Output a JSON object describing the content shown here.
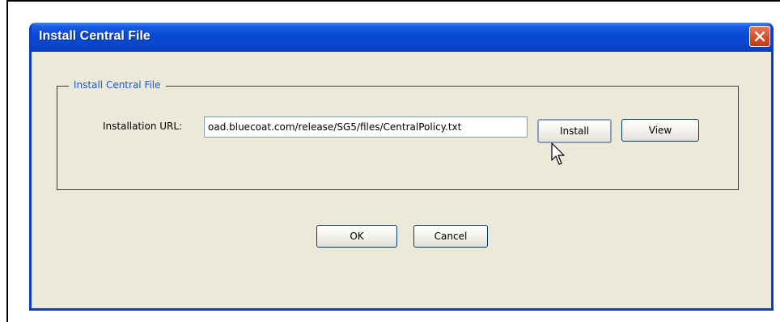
{
  "window": {
    "title": "Install Central File",
    "close_icon": "close-icon"
  },
  "group": {
    "legend": "Install Central File",
    "url_label": "Installation URL:",
    "url_value": "oad.bluecoat.com/release/SG5/files/CentralPolicy.txt",
    "install_label": "Install",
    "view_label": "View"
  },
  "footer": {
    "ok_label": "OK",
    "cancel_label": "Cancel"
  },
  "pointer": "mouse-cursor-icon",
  "colors": {
    "titlebar": "#0a4bd6",
    "dialog_bg": "#ece9d8",
    "legend_text": "#1e57c8",
    "close_button": "#d9502b"
  }
}
